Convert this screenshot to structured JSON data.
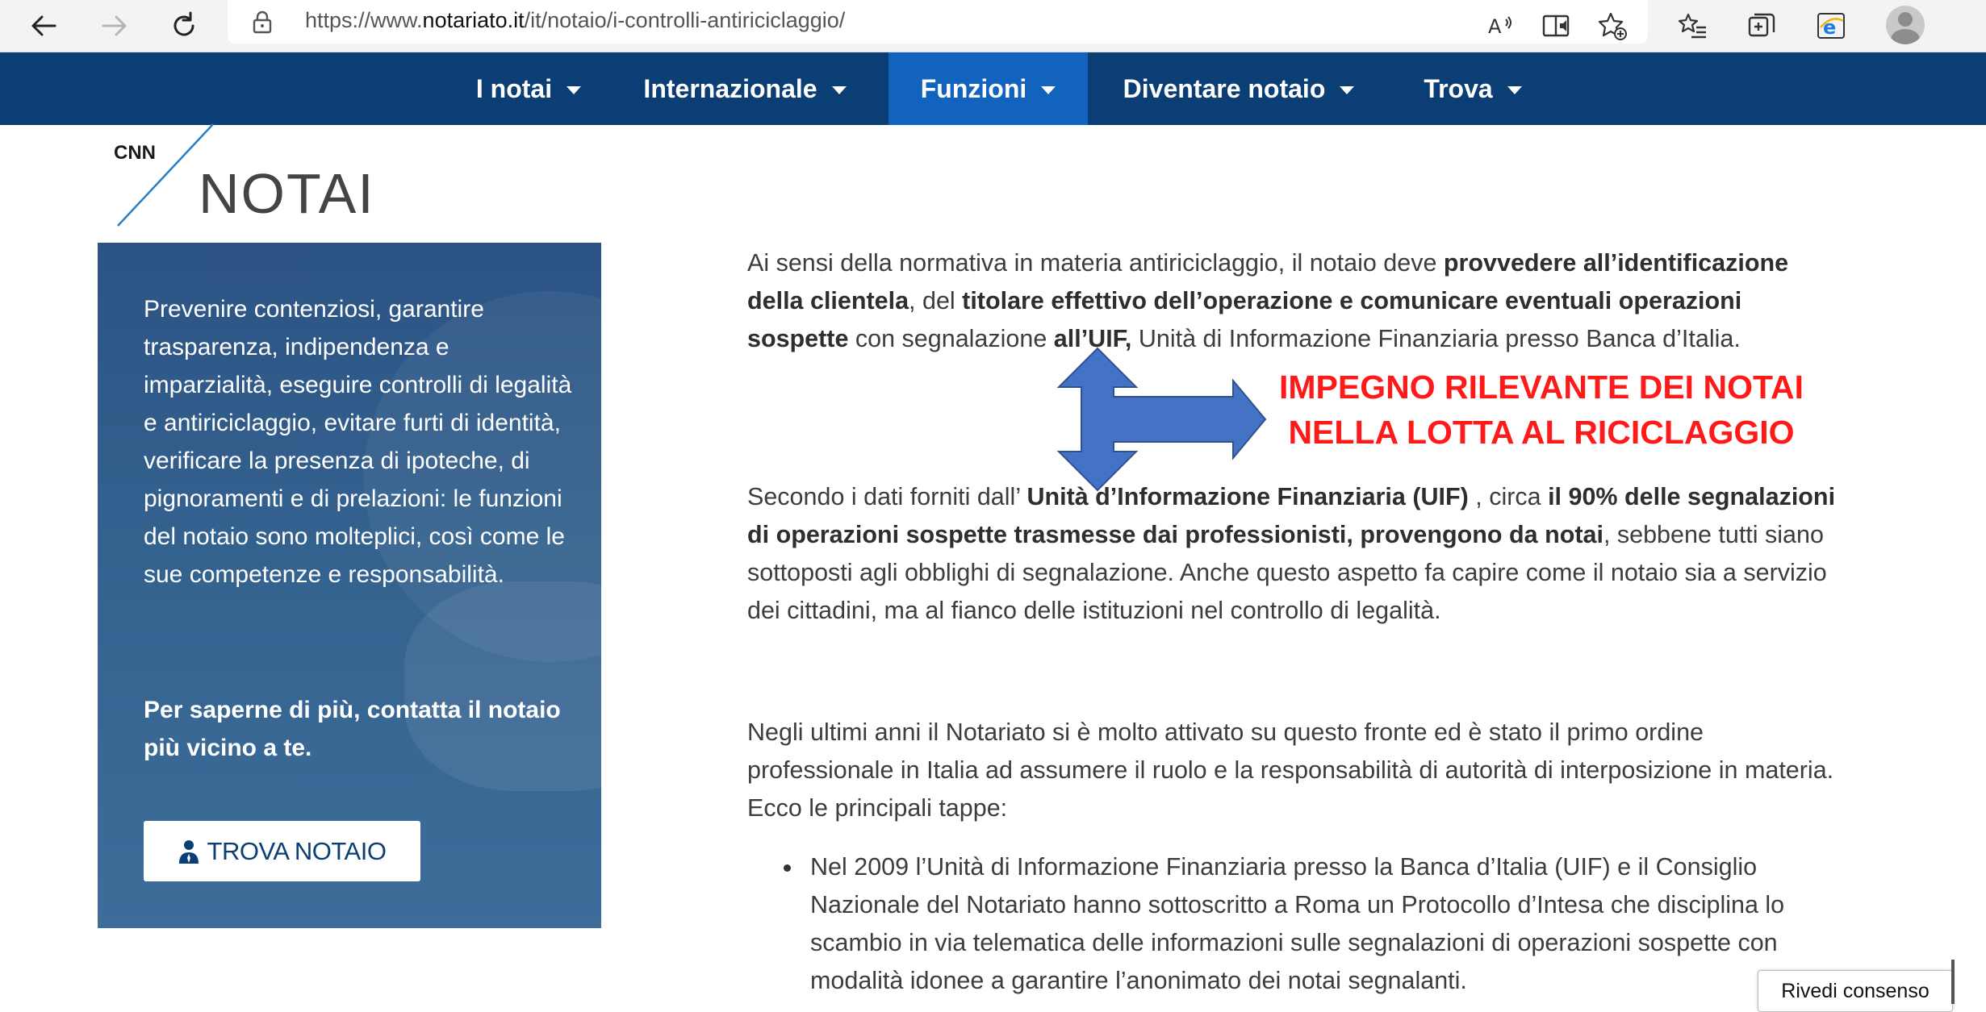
{
  "browser": {
    "url_prefix": "https://www.",
    "url_host": "notariato.it",
    "url_path": "/it/notaio/i-controlli-antiriciclaggio/"
  },
  "nav": {
    "items": [
      {
        "label": "I notai"
      },
      {
        "label": "Internazionale"
      },
      {
        "label": "Funzioni",
        "active": true
      },
      {
        "label": "Diventare notaio"
      },
      {
        "label": "Trova"
      }
    ]
  },
  "logo": {
    "small": "CNN",
    "big": "NOTAI"
  },
  "sidebar": {
    "text": "Prevenire contenziosi, garantire trasparenza, indipendenza e imparzialità, eseguire controlli di legalità e antiriciclaggio, evitare furti di identità, verificare la presenza di ipoteche, di pignoramenti e di prelazioni: le funzioni del notaio sono molteplici, così come le sue competenze e responsabilità.",
    "cta": "Per saperne di più, contatta il notaio più vicino a te.",
    "button_label": "TROVA NOTAIO"
  },
  "content": {
    "p1": {
      "t1": "Ai sensi della normativa in materia antiriciclaggio, il notaio deve ",
      "b1": "provvedere all’identificazione della clientela",
      "t2": ", del ",
      "b2": "titolare effettivo dell’operazione e comunicare eventuali operazioni sospette",
      "t3": " con segnalazione ",
      "b3": "all’UIF,",
      "t4": " Unità di Informazione Finanziaria presso Banca d’Italia."
    },
    "p2": {
      "t1": "Secondo i dati forniti dall’ ",
      "b1": "Unità d’Informazione Finanziaria (UIF)",
      "t2": " , circa ",
      "b2": "il 90% delle segnalazioni di operazioni sospette trasmesse dai professionisti, provengono da notai",
      "t3": ", sebbene tutti siano sottoposti agli obblighi di segnalazione. Anche questo aspetto fa capire come il notaio sia a servizio dei cittadini, ma al fianco delle istituzioni nel controllo di legalità."
    },
    "p3": "Negli ultimi anni il Notariato si è molto attivato su questo fronte ed è stato il primo ordine professionale in Italia ad assumere il ruolo e la responsabilità di autorità di interposizione in materia. Ecco le principali tappe:",
    "bullet1": "Nel 2009 l’Unità di Informazione Finanziaria presso la Banca d’Italia (UIF) e il Consiglio Nazionale del Notariato hanno sottoscritto a Roma un Protocollo d’Intesa che disciplina lo scambio in via telematica delle informazioni sulle segnalazioni di operazioni sospette con modalità idonee a garantire l’anonimato dei notai segnalanti."
  },
  "annotation": {
    "line1": "IMPEGNO RILEVANTE DEI NOTAI",
    "line2": "NELLA LOTTA AL RICICLAGGIO",
    "color": "#ff1a1a",
    "arrow_color": "#4472c4"
  },
  "consent": {
    "label": "Rivedi consenso"
  },
  "colors": {
    "nav_bg": "#0c3e76",
    "nav_active": "#1163bd",
    "sidebar_bg": "#2c5384"
  }
}
